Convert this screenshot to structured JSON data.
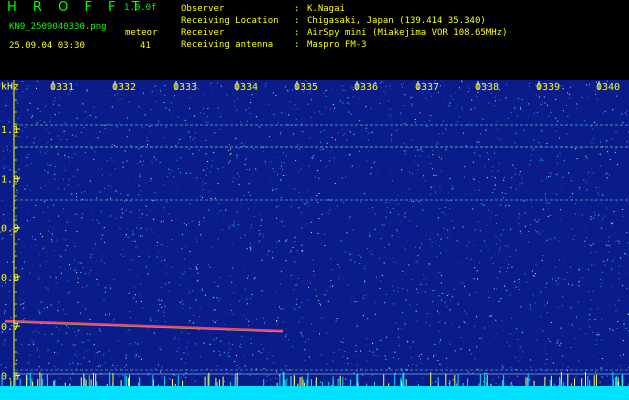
{
  "app": {
    "title": "H R O F F T",
    "version": "1.0.0f",
    "filename": "KN9_2509040330.png",
    "datetime": "25.09.04 03:30",
    "meteor_label": "meteor",
    "meteor_count": "41"
  },
  "station_info": [
    {
      "label": "Observer",
      "value": "K.Nagai"
    },
    {
      "label": "Receiving Location",
      "value": "Chigasaki, Japan (139.414 35.340)"
    },
    {
      "label": "Receiver",
      "value": "AirSpy mini (Miakejima VOR 108.65MHz)"
    },
    {
      "label": "Receiving antenna",
      "value": "Maspro FM-3"
    }
  ],
  "plot": {
    "y_unit": "kHz",
    "y_ticks": [
      "1.1",
      "1.0",
      "0.9",
      "0.8",
      "0.7",
      "0.6"
    ],
    "time_labels": [
      "0331",
      "0332",
      "0333",
      "0334",
      "0335",
      "0336",
      "0337",
      "0338",
      "0339",
      "0340"
    ],
    "colors": {
      "background": "#0a1c8a",
      "axis": "#ffff00",
      "meteor_trace": "#ff3b6a",
      "carrier_lines": "#6fe0d0",
      "noise_floor": "#00e0ff"
    }
  }
}
